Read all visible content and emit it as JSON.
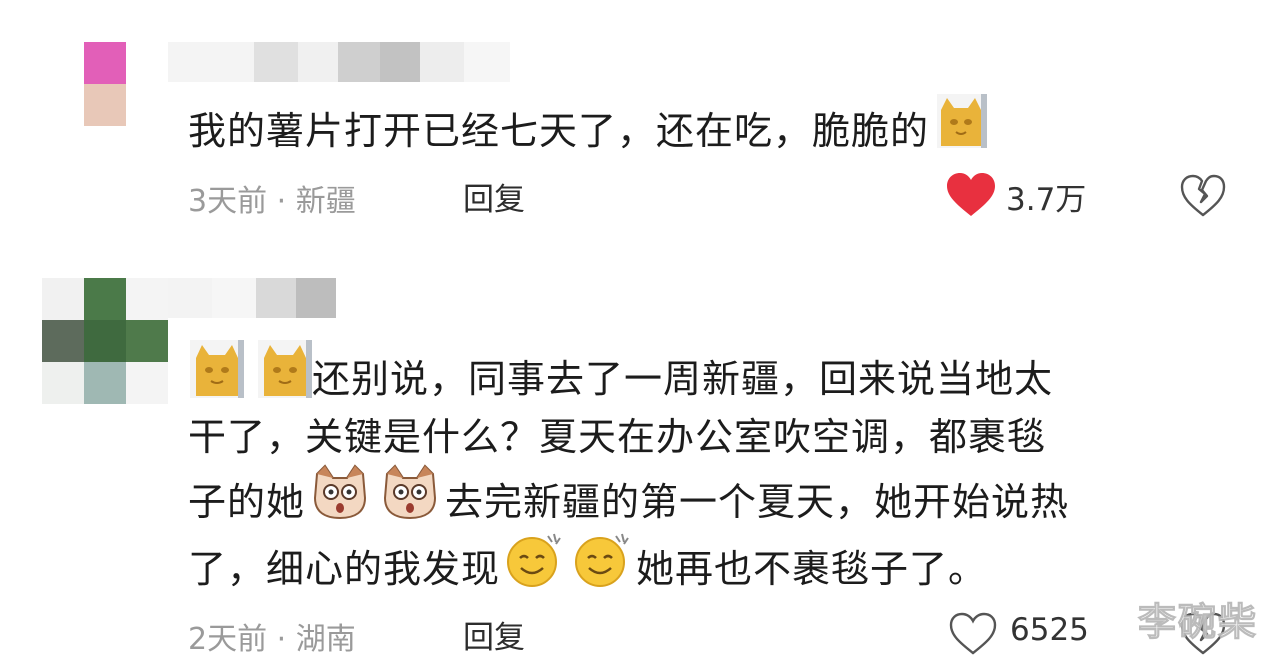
{
  "comments": [
    {
      "text": "我的薯片打开已经七天了，还在吃，脆脆的",
      "time": "3天前",
      "separator": "·",
      "location": "新疆",
      "reply_label": "回复",
      "like_count": "3.7万",
      "liked": true,
      "icons": [
        "cat-emoji-icon",
        "heart-filled-icon",
        "broken-heart-icon"
      ]
    },
    {
      "lines": [
        "还别说，同事去了一周新疆，回来说当地太",
        "干了，关键是什么？夏天在办公室吹空调，都裹毯",
        "子的她",
        "去完新疆的第一个夏天，她开始说热",
        "了，细心的我发现",
        "她再也不裹毯子了。"
      ],
      "time": "2天前",
      "separator": "·",
      "location": "湖南",
      "reply_label": "回复",
      "like_count": "6525",
      "liked": false,
      "icons": [
        "cat-emoji-icon",
        "shocked-dog-emoji-icon",
        "smile-sweat-emoji-icon",
        "heart-outline-icon",
        "broken-heart-icon"
      ]
    }
  ],
  "watermark": "李碗柴",
  "colors": {
    "like_red": "#e8303f",
    "meta_gray": "#9a9a9a",
    "emoji_gold": "#e9b33a"
  }
}
